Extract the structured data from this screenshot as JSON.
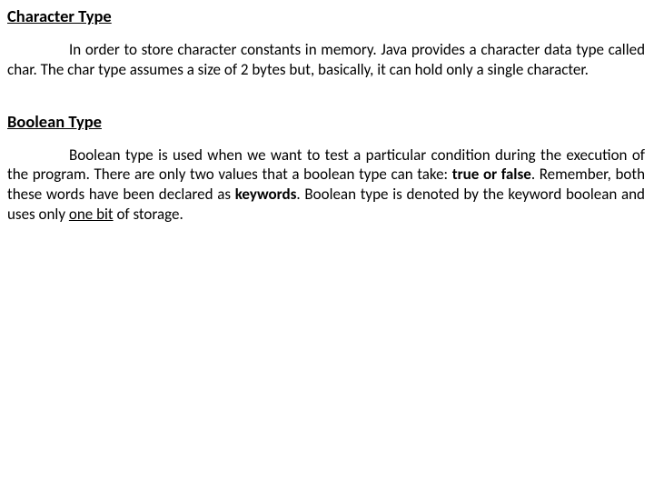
{
  "sections": [
    {
      "heading": "Character Type",
      "para_parts": [
        {
          "t": "In order to store character constants in memory. Java provides a character data type called char. The char type assumes a size of 2 bytes but, basically, it can hold only a single character."
        }
      ]
    },
    {
      "heading": "Boolean Type",
      "para_parts": [
        {
          "t": "Boolean type is used when we want to test a particular condition during the execution of the program. There are only two values that a boolean type can take: "
        },
        {
          "t": "true or false",
          "bold": true
        },
        {
          "t": ". Remember, both these words have been declared as "
        },
        {
          "t": "keywords",
          "bold": true
        },
        {
          "t": ". Boolean type is denoted by the keyword boolean and uses only "
        },
        {
          "t": "one bit",
          "underline": true
        },
        {
          "t": " of storage."
        }
      ]
    }
  ]
}
